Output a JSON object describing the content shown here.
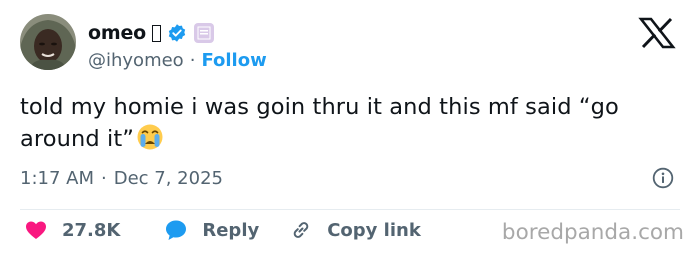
{
  "author": {
    "display_name": "omeo",
    "handle": "@ihyomeo",
    "separator": "·",
    "follow_label": "Follow"
  },
  "tweet": {
    "text": "told my homie i was goin thru it and this mf said “go around it”",
    "time": "1:17 AM",
    "separator": "·",
    "date": "Dec 7, 2025"
  },
  "actions": {
    "likes": "27.8K",
    "reply_label": "Reply",
    "copy_link_label": "Copy link"
  },
  "watermark": "boredpanda.com",
  "icons": [
    "x-logo-icon",
    "verified-badge-icon",
    "info-icon",
    "heart-icon",
    "reply-bubble-icon",
    "link-icon",
    "crying-face-emoji"
  ],
  "colors": {
    "accent": "#1d9bf0",
    "like": "#f91880",
    "text": "#0f1419",
    "secondary": "#536471"
  }
}
